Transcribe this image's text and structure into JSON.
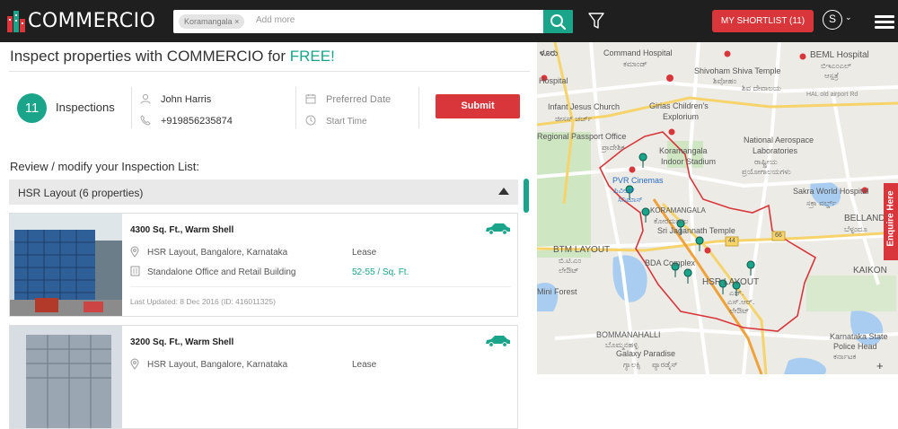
{
  "header": {
    "logo_text": "COMMERCIO",
    "search_chip": "Koramangala",
    "search_chip_close": "×",
    "search_placeholder": "Add more",
    "shortlist_label": "MY SHORTLIST (11)",
    "avatar_initial": "S",
    "avatar_caret": "⌄"
  },
  "page": {
    "heading_prefix": "Inspect properties with COMMERCIO for ",
    "heading_highlight": "FREE!",
    "inspection_count": "11",
    "inspection_label": "Inspections",
    "contact_name": "John Harris",
    "contact_phone": "+919856235874",
    "date_placeholder": "Preferred Date",
    "time_placeholder": "Start Time",
    "submit_label": "Submit",
    "review_heading": "Review / modify your Inspection List:",
    "group_title": "HSR Layout (6 properties)"
  },
  "listings": [
    {
      "title": "4300 Sq. Ft., Warm Shell",
      "location": "HSR Layout, Bangalore, Karnataka",
      "type": "Standalone Office and Retail Building",
      "deal": "Lease",
      "price": "52-55 / Sq. Ft.",
      "updated": "Last Updated: 8 Dec 2016 (ID: 416011325)"
    },
    {
      "title": "3200 Sq. Ft., Warm Shell",
      "location": "HSR Layout, Bangalore, Karnataka",
      "deal": "Lease"
    }
  ],
  "map": {
    "labels": [
      "Command Hospital",
      "ಕಮಾಂಡ್",
      "Shivoham Shiva Temple",
      "ಶಿವೋಹಂ",
      "ಶಿವ ದೇವಾಲಯ",
      "BEML Hospital",
      "ಬಿಇಎಂಎಲ್",
      "ಆಸ್ಪತ್ರೆ",
      "HAL old airport Rd",
      "Hospital",
      "ಳೂರು",
      "Infant Jesus Church",
      "ಜೀಸಸ್ ಚರ್ಚ್",
      "Girias Children's",
      "Explorium",
      "Regional Passport Office",
      "ಪ್ರಾದೇಶಿಕ",
      "Koramangala",
      "Indoor Stadium",
      "National Aerospace",
      "Laboratories",
      "ರಾಷ್ಟ್ರೀಯ",
      "ಪ್ರಯೋಗಾಲಯಗಳು",
      "PVR Cinemas",
      "ಪಿವಿಆರ್",
      "ಸಿನಿಮಾಸ್",
      "KORAMANGALA",
      "ಕೋರಮಂಗಲ",
      "Sri Jagannath Temple",
      "Sakra World Hospital",
      "ಸಕ್ರಾ ವರ್ಲ್ಡ್",
      "BELLAND",
      "ಬೆಳ್ಳಂದೂ",
      "BTM LAYOUT",
      "ಬಿ.ಟಿ.ಎಂ",
      "ಲೇಔಟ್",
      "BDA Complex",
      "HSR LAYOUT",
      "ಎಚ್.",
      "ಎಸ್.ಆರ್.",
      "ಲೇಔಟ್",
      "KAIKON",
      "Mini Forest",
      "BOMMANAHALLI",
      "ಬೊಮ್ಮನಹಳ್ಳಿ",
      "Galaxy Paradise",
      "ಗ್ಯಾಲಕ್ಸಿ",
      "ಪ್ಯಾರಡೈಸ್",
      "Karnataka State",
      "Police Head",
      "ಕರ್ನಾಟಕ",
      "44",
      "66"
    ],
    "enquire_label": "Enquire Here",
    "zoom_in": "+"
  },
  "colors": {
    "accent_green": "#1aa58a",
    "accent_red": "#d9363b",
    "topbar": "#1f1f1f"
  }
}
